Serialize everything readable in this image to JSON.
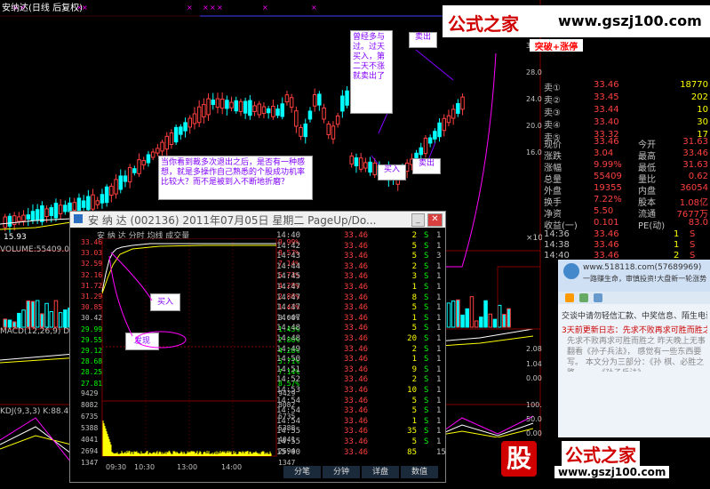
{
  "main": {
    "title": "安纳达(日线 后复权)",
    "ma_label": "15.93",
    "volume_label": "VOLUME:55409.00 MA",
    "macd_label": "MACD(12,26,9) DIF:1.8",
    "kdj_label": "KDJ(9,3,3) K:88.49 D:"
  },
  "annotations": {
    "note1": "曾经多与过。过天买入，第二天不涨就卖出了",
    "note2": "当你看到裁多次退出之后，是否有一种感想，就是多操作自己熟悉的个股成功机率比较大？而不是被到入不断地折磨？",
    "sell1": "卖出",
    "sell2": "卖出",
    "buy1": "买入",
    "buy_popup": "买入",
    "find_popup": "发现",
    "breakout": "突破+涨停"
  },
  "watermark": {
    "brand": "公式之家",
    "url": "www.gszj100.com",
    "logo_char": "股",
    "brand2": "公式之家",
    "url2": "www.gszj100.com"
  },
  "quote": {
    "asks": [
      {
        "label": "卖①",
        "price": "33.46",
        "vol": "18770"
      },
      {
        "label": "卖②",
        "price": "33.45",
        "vol": "202"
      },
      {
        "label": "卖③",
        "price": "33.44",
        "vol": "10"
      },
      {
        "label": "卖④",
        "price": "33.40",
        "vol": "30"
      },
      {
        "label": "卖⑤",
        "price": "33.32",
        "vol": "17"
      }
    ],
    "stats": [
      {
        "l1": "现价",
        "v1": "33.46",
        "l2": "今开",
        "v2": "31.63"
      },
      {
        "l1": "涨跌",
        "v1": "3.04",
        "l2": "最高",
        "v2": "33.46"
      },
      {
        "l1": "涨幅",
        "v1": "9.99%",
        "l2": "最低",
        "v2": "31.63"
      },
      {
        "l1": "总量",
        "v1": "55409",
        "l2": "量比",
        "v2": "0.62"
      },
      {
        "l1": "外盘",
        "v1": "19355",
        "l2": "内盘",
        "v2": "36054"
      },
      {
        "l1": "换手",
        "v1": "7.22%",
        "l2": "股本",
        "v2": "1.08亿"
      },
      {
        "l1": "净资",
        "v1": "5.50",
        "l2": "流通",
        "v2": "7677万"
      },
      {
        "l1": "收益(一)",
        "v1": "0.101",
        "l2": "PE(动)",
        "v2": "83.0"
      }
    ],
    "ticks": [
      {
        "t": "14:36",
        "p": "33.46",
        "v": "1",
        "d": "S"
      },
      {
        "t": "14:38",
        "p": "33.46",
        "v": "1",
        "d": "S"
      },
      {
        "t": "14:40",
        "p": "33.46",
        "v": "2",
        "d": "S"
      }
    ]
  },
  "popup": {
    "title": "安 纳 达 (002136)  2011年07月05日  星期二  PageUp/Do...",
    "chart_header": "安 纳 达   分时 均线 成交量",
    "price_axis": [
      "33.46",
      "33.03",
      "32.59",
      "32.16",
      "31.72",
      "31.29",
      "30.85",
      "30.42",
      "29.99",
      "29.55",
      "29.12",
      "28.68",
      "28.25",
      "27.81"
    ],
    "pct_axis": [
      "9.99%",
      "8.57%",
      "7.14%",
      "5.71%",
      "4.28%",
      "2.86%",
      "1.43%",
      "0.00%",
      "1.43%",
      "2.86%",
      "4.28%",
      "5.71%",
      "7.14%",
      "8.57%"
    ],
    "vol_axis": [
      "9429",
      "8082",
      "6735",
      "5388",
      "4041",
      "2694",
      "1347"
    ],
    "time_axis": [
      "09:30",
      "10:30",
      "13:00",
      "14:00"
    ],
    "ticks": [
      {
        "t": "14:40",
        "p": "33.46",
        "v": "2",
        "d": "S",
        "n": "1"
      },
      {
        "t": "14:42",
        "p": "33.46",
        "v": "5",
        "d": "S",
        "n": "1"
      },
      {
        "t": "14:43",
        "p": "33.46",
        "v": "5",
        "d": "S",
        "n": "3"
      },
      {
        "t": "14:44",
        "p": "33.46",
        "v": "2",
        "d": "S",
        "n": "1"
      },
      {
        "t": "14:45",
        "p": "33.46",
        "v": "3",
        "d": "S",
        "n": "1"
      },
      {
        "t": "14:47",
        "p": "33.46",
        "v": "1",
        "d": "S",
        "n": "1"
      },
      {
        "t": "14:47",
        "p": "33.46",
        "v": "8",
        "d": "S",
        "n": "1"
      },
      {
        "t": "14:47",
        "p": "33.46",
        "v": "5",
        "d": "S",
        "n": "1"
      },
      {
        "t": "14:47",
        "p": "33.46",
        "v": "1",
        "d": "S",
        "n": "1"
      },
      {
        "t": "14:48",
        "p": "33.46",
        "v": "5",
        "d": "S",
        "n": "1"
      },
      {
        "t": "14:48",
        "p": "33.46",
        "v": "20",
        "d": "S",
        "n": "1"
      },
      {
        "t": "14:49",
        "p": "33.46",
        "v": "2",
        "d": "S",
        "n": "1"
      },
      {
        "t": "14:50",
        "p": "33.46",
        "v": "1",
        "d": "S",
        "n": "1"
      },
      {
        "t": "14:51",
        "p": "33.46",
        "v": "9",
        "d": "S",
        "n": "1"
      },
      {
        "t": "14:52",
        "p": "33.46",
        "v": "2",
        "d": "S",
        "n": "1"
      },
      {
        "t": "14:53",
        "p": "33.46",
        "v": "10",
        "d": "S",
        "n": "1"
      },
      {
        "t": "14:54",
        "p": "33.46",
        "v": "5",
        "d": "S",
        "n": "1"
      },
      {
        "t": "14:54",
        "p": "33.46",
        "v": "5",
        "d": "S",
        "n": "1"
      },
      {
        "t": "14:54",
        "p": "33.46",
        "v": "1",
        "d": "S",
        "n": "1"
      },
      {
        "t": "14:55",
        "p": "33.46",
        "v": "35",
        "d": "S",
        "n": "1"
      },
      {
        "t": "14:55",
        "p": "33.46",
        "v": "5",
        "d": "S",
        "n": "1"
      },
      {
        "t": "15:00",
        "p": "33.46",
        "v": "85",
        "d": "",
        "n": "15"
      }
    ],
    "tabs": [
      "分笔",
      "分钟",
      "详盘",
      "数值"
    ]
  },
  "chat": {
    "url": "www.518118.com(57689969)",
    "line1": "一路赚生命，审慎投资!大盘新一轮涨势!",
    "line2": "交谈中请勿轻信汇款、中奖信息、陌生电话，",
    "line3": "3天前更新日志：先求不败再求可胜而胜之",
    "line4": "先求不败再求可胜而胜之 昨天晚上无事翻看《孙子兵法》，",
    "line5": "感觉有一些东西要写。 本文分为三部分：《孙",
    "line6": "棋、必胜之路。 一、《孙子兵法》—"
  },
  "colors": {
    "up": "#ff4040",
    "down": "#00ffff",
    "price": "#ff4040",
    "vol": "#ffff00"
  }
}
